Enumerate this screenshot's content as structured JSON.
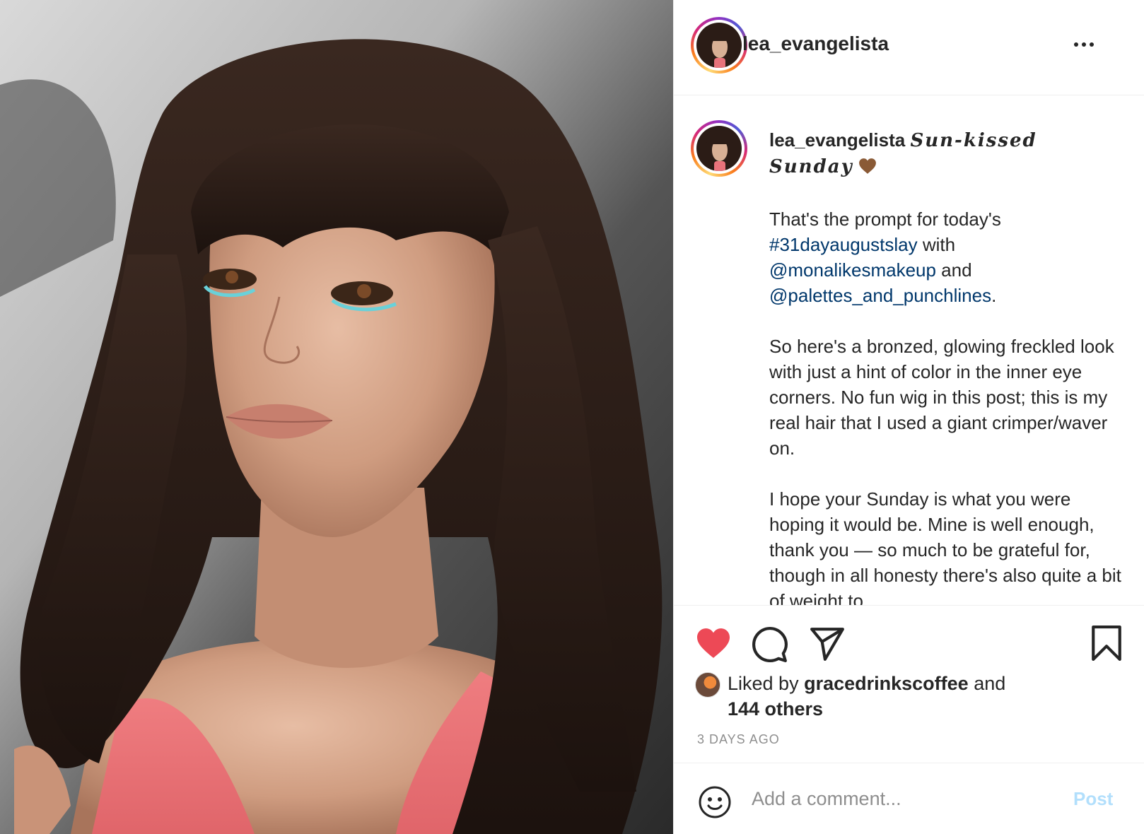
{
  "post": {
    "author": "lea_evangelista",
    "caption": {
      "title_script": "Sun-kissed Sunday",
      "title_emoji": "🤎",
      "p1_text_a": "That's the prompt for today's ",
      "p1_hashtag": "#31dayaugustslay",
      "p1_text_b": " with ",
      "p1_mention1": "@monalikesmakeup",
      "p1_text_c": " and ",
      "p1_mention2": "@palettes_and_punchlines",
      "p1_text_d": ".",
      "p2": "So here's a bronzed, glowing freckled look with just a hint of color in the inner eye corners. No fun wig in this post; this is my real hair that I used a giant crimper/waver on.",
      "p3": "I hope your Sunday is what you were hoping it would be. Mine is well enough, thank you — so much to be grateful for, though in all honesty there's also quite a bit of weight to"
    },
    "likes": {
      "prefix": "Liked by ",
      "liker": "gracedrinkscoffee",
      "middle": " and",
      "others": "144 others"
    },
    "timestamp": "3 DAYS AGO",
    "liked": true
  },
  "comment": {
    "placeholder": "Add a comment...",
    "post_label": "Post"
  },
  "icons": {
    "more": "more-horizontal-icon",
    "like": "heart-icon",
    "comment": "comment-icon",
    "share": "paper-plane-icon",
    "save": "bookmark-icon",
    "emoji": "smiley-icon"
  },
  "colors": {
    "like_red": "#ed4956",
    "link_blue": "#00376b",
    "post_button_disabled": "#b2dffc",
    "muted_gray": "#8e8e8e"
  }
}
